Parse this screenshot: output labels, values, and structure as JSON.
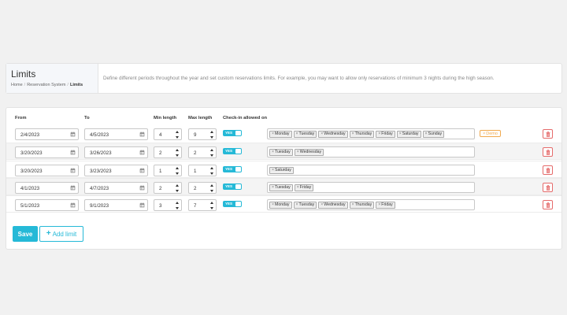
{
  "header": {
    "title": "Limits",
    "breadcrumb": [
      "Home",
      "Reservation System",
      "Limits"
    ],
    "description": "Define different periods throughout the year and set custom reservations limits. For example, you may want to allow only reservations of minimum 3 nights during the high season."
  },
  "table": {
    "columns": {
      "from": "From",
      "to": "To",
      "min": "Min length",
      "max": "Max length",
      "checkin": "Check-in allowed on"
    },
    "rows": [
      {
        "from": "2/4/2023",
        "to": "4/5/2023",
        "min": "4",
        "max": "9",
        "toggle": "YES",
        "days": [
          "Monday",
          "Tuesday",
          "Wednesday",
          "Thursday",
          "Friday",
          "Saturday",
          "Sunday"
        ],
        "badge": "Demo"
      },
      {
        "from": "3/20/2023",
        "to": "3/26/2023",
        "min": "2",
        "max": "2",
        "toggle": "YES",
        "days": [
          "Tuesday",
          "Wednesday"
        ]
      },
      {
        "from": "3/20/2023",
        "to": "3/23/2023",
        "min": "1",
        "max": "1",
        "toggle": "YES",
        "days": [
          "Saturday"
        ]
      },
      {
        "from": "4/1/2023",
        "to": "4/7/2023",
        "min": "2",
        "max": "2",
        "toggle": "YES",
        "days": [
          "Tuesday",
          "Friday"
        ]
      },
      {
        "from": "5/1/2023",
        "to": "9/1/2023",
        "min": "3",
        "max": "7",
        "toggle": "YES",
        "days": [
          "Monday",
          "Tuesday",
          "Wednesday",
          "Thursday",
          "Friday"
        ]
      }
    ]
  },
  "actions": {
    "save": "Save",
    "add": "Add limit"
  },
  "colors": {
    "accent": "#25b9d7",
    "danger": "#e56b6b",
    "demo": "#f0a94e"
  },
  "icons": {
    "calendar": "calendar-icon",
    "delete": "trash-icon",
    "remove_tag": "close-icon",
    "spinner": "spinner-icon",
    "add": "plus-icon"
  }
}
